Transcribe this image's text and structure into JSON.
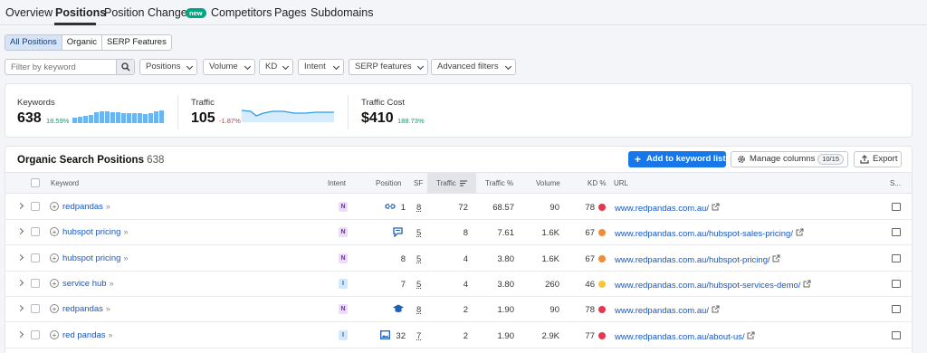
{
  "nav": {
    "tabs": [
      "Overview",
      "Positions",
      "Position Changes",
      "Competitors",
      "Pages",
      "Subdomains"
    ],
    "new_badge": "new",
    "active": "Positions"
  },
  "filters": {
    "segments": [
      "All Positions",
      "Organic",
      "SERP Features"
    ],
    "active_segment": "All Positions",
    "search_placeholder": "Filter by keyword",
    "dropdowns": [
      "Positions",
      "Volume",
      "KD",
      "Intent",
      "SERP features",
      "Advanced filters"
    ]
  },
  "summary": {
    "keywords": {
      "label": "Keywords",
      "value": "638",
      "change": "18.59%"
    },
    "traffic": {
      "label": "Traffic",
      "value": "105",
      "change": "-1.87%"
    },
    "traffic_cost": {
      "label": "Traffic Cost",
      "value": "$410",
      "change": "188.73%"
    }
  },
  "table": {
    "title": "Organic Search Positions",
    "count": "638",
    "add_button": "Add to keyword list",
    "manage_button": "Manage columns",
    "manage_count": "10/15",
    "export_button": "Export",
    "headers": {
      "keyword": "Keyword",
      "intent": "Intent",
      "position": "Position",
      "sf": "SF",
      "traffic": "Traffic",
      "traffic_pct": "Traffic %",
      "volume": "Volume",
      "kd": "KD %",
      "url": "URL",
      "serp": "S..."
    },
    "rows": [
      {
        "keyword": "redpandas",
        "intent": "N",
        "pos_icon": "link-icon",
        "position": "1",
        "sf": "8",
        "traffic": "72",
        "traffic_pct": "68.57",
        "volume": "90",
        "kd": "78",
        "kd_color": "#e5384e",
        "url": "www.redpandas.com.au/"
      },
      {
        "keyword": "hubspot pricing",
        "intent": "N",
        "pos_icon": "comment-icon",
        "position": "",
        "sf": "5",
        "traffic": "8",
        "traffic_pct": "7.61",
        "volume": "1.6K",
        "kd": "67",
        "kd_color": "#f08c39",
        "url": "www.redpandas.com.au/hubspot-sales-pricing/"
      },
      {
        "keyword": "hubspot pricing",
        "intent": "N",
        "pos_icon": "",
        "position": "8",
        "sf": "5",
        "traffic": "4",
        "traffic_pct": "3.80",
        "volume": "1.6K",
        "kd": "67",
        "kd_color": "#f08c39",
        "url": "www.redpandas.com.au/hubspot-pricing/"
      },
      {
        "keyword": "service hub",
        "intent": "I",
        "pos_icon": "",
        "position": "7",
        "sf": "5",
        "traffic": "4",
        "traffic_pct": "3.80",
        "volume": "260",
        "kd": "46",
        "kd_color": "#f5c53b",
        "url": "www.redpandas.com.au/hubspot-services-demo/"
      },
      {
        "keyword": "redpandas",
        "intent": "N",
        "pos_icon": "graduation-cap-icon",
        "position": "",
        "sf": "8",
        "traffic": "2",
        "traffic_pct": "1.90",
        "volume": "90",
        "kd": "78",
        "kd_color": "#e5384e",
        "url": "www.redpandas.com.au/"
      },
      {
        "keyword": "red pandas",
        "intent": "I",
        "pos_icon": "image-icon",
        "position": "32",
        "sf": "7",
        "traffic": "2",
        "traffic_pct": "1.90",
        "volume": "2.9K",
        "kd": "77",
        "kd_color": "#e5384e",
        "url": "www.redpandas.com.au/about-us/"
      }
    ]
  },
  "colors": {
    "accent": "#1777e8",
    "link": "#1857c2",
    "new_badge": "#00a582"
  }
}
